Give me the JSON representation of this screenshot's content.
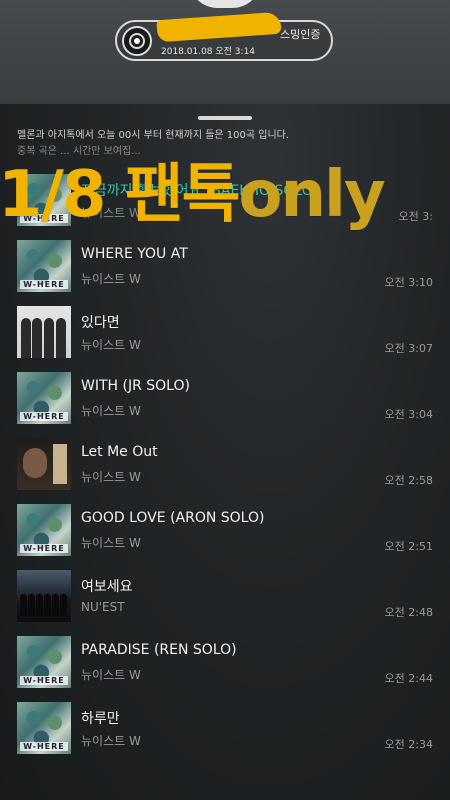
{
  "streaming": {
    "title": "스밍인증",
    "datetime": "2018.01.08 오전 3:14"
  },
  "notice": {
    "line1": "멜론과 아지톡에서 오늘 00시 부터 현재까지 들은 100곡 입니다.",
    "line2": "중복 곡은 ... 시간만 보여집..."
  },
  "overlay": {
    "main": "1/8 팬톡",
    "suffix": "only"
  },
  "tracks": [
    {
      "title": "지금까지 행보했어요 (BAEKHO SOLO)",
      "artist": "뉴이스트 W",
      "time": "오전 3:",
      "art": "where",
      "current": true
    },
    {
      "title": "WHERE YOU AT",
      "artist": "뉴이스트 W",
      "time": "오전 3:10",
      "art": "where"
    },
    {
      "title": "있다면",
      "artist": "뉴이스트 W",
      "time": "오전 3:07",
      "art": "group"
    },
    {
      "title": "WITH (JR SOLO)",
      "artist": "뉴이스트 W",
      "time": "오전 3:04",
      "art": "where"
    },
    {
      "title": "Let Me Out",
      "artist": "뉴이스트 W",
      "time": "오전 2:58",
      "art": "dark"
    },
    {
      "title": "GOOD LOVE (ARON SOLO)",
      "artist": "뉴이스트 W",
      "time": "오전 2:51",
      "art": "where"
    },
    {
      "title": "여보세요",
      "artist": "NU'EST",
      "time": "오전 2:48",
      "art": "night"
    },
    {
      "title": "PARADISE (REN SOLO)",
      "artist": "뉴이스트 W",
      "time": "오전 2:44",
      "art": "where"
    },
    {
      "title": "하루만",
      "artist": "뉴이스트 W",
      "time": "오전 2:34",
      "art": "where"
    }
  ],
  "art_word": "W-HERE",
  "colors": {
    "accent_yellow": "#f0b400",
    "current_teal": "#34c7a6"
  }
}
